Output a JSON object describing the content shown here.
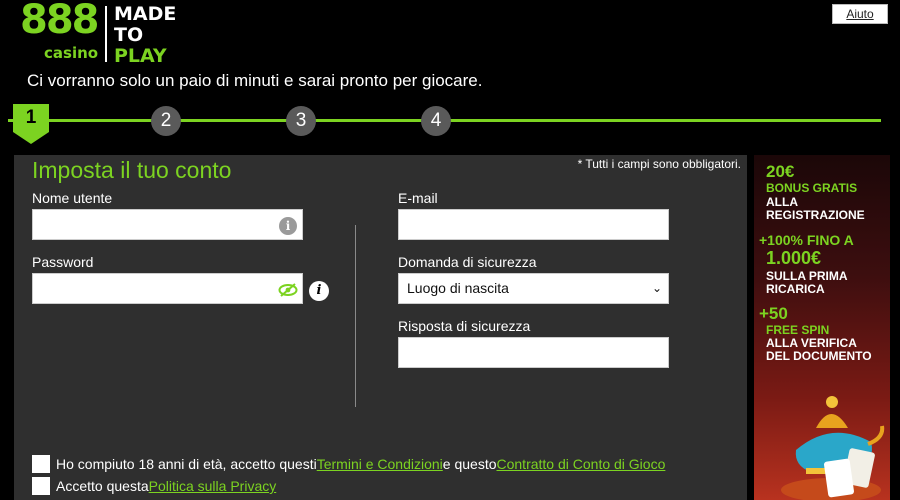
{
  "header": {
    "logo_number": "888",
    "logo_casino": "casino",
    "logo_made": "MADE",
    "logo_to": "TO",
    "logo_play": "PLAY",
    "help_label": "Aiuto",
    "subtitle": "Ci vorranno solo un paio di minuti e sarai pronto per giocare."
  },
  "stepper": {
    "steps": [
      "1",
      "2",
      "3",
      "4"
    ],
    "active_step": 1
  },
  "form": {
    "title": "Imposta il tuo conto",
    "required_note": "* Tutti i campi sono obbligatori.",
    "username_label": "Nome utente",
    "username_value": "",
    "password_label": "Password",
    "password_value": "",
    "email_label": "E-mail",
    "email_value": "",
    "security_question_label": "Domanda di sicurezza",
    "security_question_value": "Luogo di nascita",
    "security_answer_label": "Risposta di sicurezza",
    "security_answer_value": "",
    "consent_age_text_1": "Ho compiuto 18 anni di età, accetto questi ",
    "consent_age_link_1": "Termini e Condizioni",
    "consent_age_text_2": " e questo ",
    "consent_age_link_2": "Contratto di Conto di Gioco",
    "consent_privacy_text": "Accetto questa ",
    "consent_privacy_link": "Politica sulla Privacy"
  },
  "banner": {
    "line1": "20€",
    "line2": "BONUS GRATIS",
    "line3": "ALLA",
    "line4": "REGISTRAZIONE",
    "line5": "+100% FINO A",
    "line6": "1.000€",
    "line7": "SULLA PRIMA",
    "line8": "RICARICA",
    "line9": "+50",
    "line10": "FREE SPIN",
    "line11": "ALLA VERIFICA",
    "line12": "DEL DOCUMENTO"
  },
  "colors": {
    "accent": "#7cd321",
    "panel": "#2f2f2f",
    "background": "#000000"
  }
}
